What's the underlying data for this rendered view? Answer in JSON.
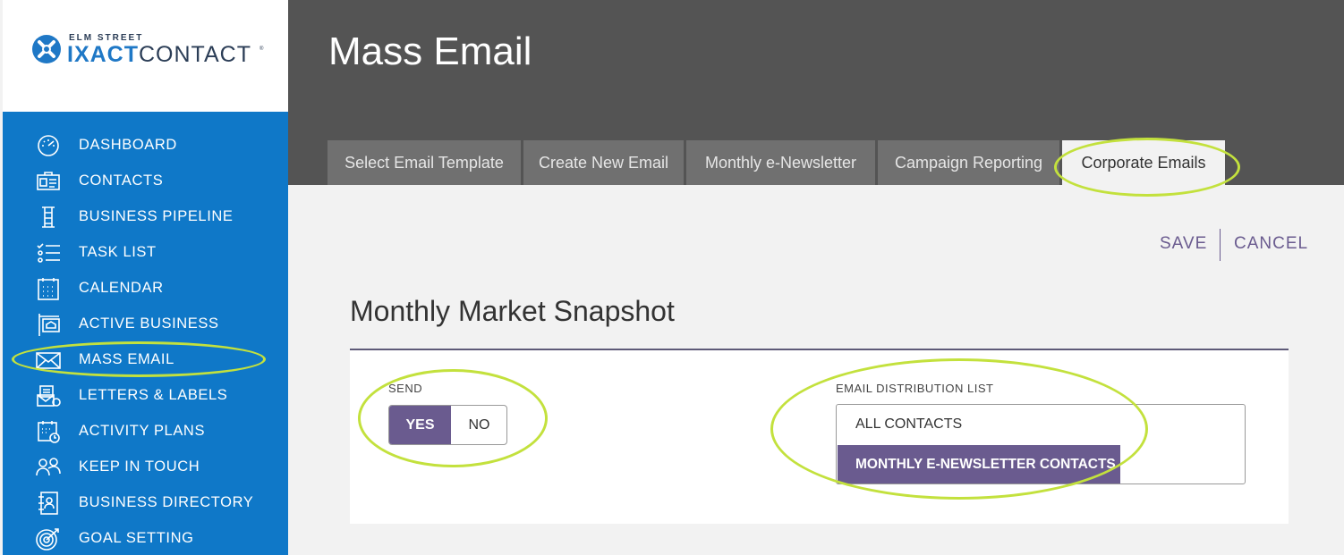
{
  "logo": {
    "top_text": "ELM STREET",
    "brand_part1": "IXACT",
    "brand_part2": "CONTACT",
    "tm": "®"
  },
  "sidebar": {
    "items": [
      {
        "label": "DASHBOARD",
        "icon": "speedometer-icon"
      },
      {
        "label": "CONTACTS",
        "icon": "contacts-card-icon"
      },
      {
        "label": "BUSINESS PIPELINE",
        "icon": "pipeline-icon"
      },
      {
        "label": "TASK LIST",
        "icon": "checklist-icon"
      },
      {
        "label": "CALENDAR",
        "icon": "calendar-icon"
      },
      {
        "label": "ACTIVE BUSINESS",
        "icon": "house-sign-icon"
      },
      {
        "label": "MASS EMAIL",
        "icon": "envelope-icon"
      },
      {
        "label": "LETTERS & LABELS",
        "icon": "letters-icon"
      },
      {
        "label": "ACTIVITY PLANS",
        "icon": "calendar-clock-icon"
      },
      {
        "label": "KEEP IN TOUCH",
        "icon": "people-icon"
      },
      {
        "label": "BUSINESS DIRECTORY",
        "icon": "directory-book-icon"
      },
      {
        "label": "GOAL SETTING",
        "icon": "target-icon"
      }
    ]
  },
  "header": {
    "title": "Mass Email",
    "tabs": [
      {
        "label": "Select Email Template"
      },
      {
        "label": "Create New Email"
      },
      {
        "label": "Monthly e-Newsletter"
      },
      {
        "label": "Campaign Reporting"
      },
      {
        "label": "Corporate Emails",
        "active": true
      }
    ]
  },
  "actions": {
    "save": "SAVE",
    "cancel": "CANCEL"
  },
  "content": {
    "section_title": "Monthly Market Snapshot",
    "send": {
      "label": "SEND",
      "yes": "YES",
      "no": "NO",
      "selected": "YES"
    },
    "distribution": {
      "label": "EMAIL DISTRIBUTION LIST",
      "options": [
        "ALL CONTACTS",
        "MONTHLY E-NEWSLETTER CONTACTS"
      ],
      "selected": "MONTHLY E-NEWSLETTER CONTACTS"
    }
  },
  "colors": {
    "sidebar": "#0f78c8",
    "header": "#545454",
    "tab": "#707070",
    "accent": "#6a5b8f",
    "annotation": "#c3e13d"
  }
}
